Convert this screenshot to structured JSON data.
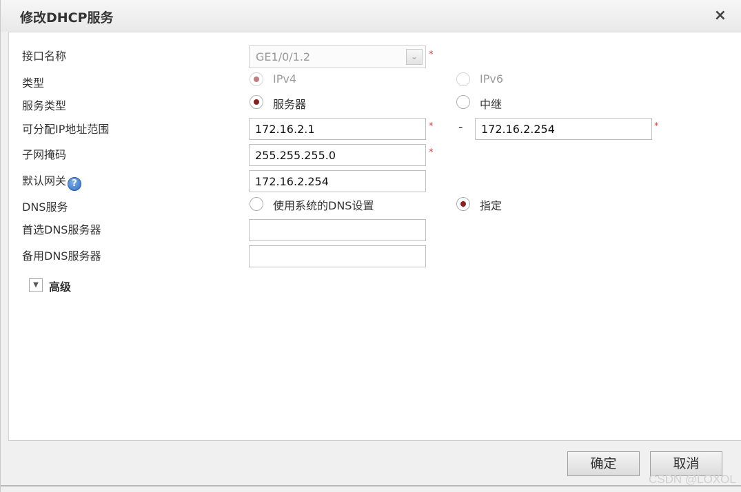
{
  "dialog": {
    "title": "修改DHCP服务",
    "close_symbol": "×"
  },
  "fields": {
    "interface_name": {
      "label": "接口名称",
      "value": "GE1/0/1.2",
      "required": "*"
    },
    "type": {
      "label": "类型",
      "options": [
        "IPv4",
        "IPv6"
      ],
      "selected": "IPv4"
    },
    "service_type": {
      "label": "服务类型",
      "options": [
        "服务器",
        "中继"
      ],
      "selected": "服务器"
    },
    "ip_range": {
      "label": "可分配IP地址范围",
      "start": "172.16.2.1",
      "separator": "-",
      "end": "172.16.2.254",
      "required": "*"
    },
    "subnet_mask": {
      "label": "子网掩码",
      "value": "255.255.255.0",
      "required": "*"
    },
    "default_gateway": {
      "label": "默认网关",
      "value": "172.16.2.254",
      "help_symbol": "?"
    },
    "dns_service": {
      "label": "DNS服务",
      "options": [
        "使用系统的DNS设置",
        "指定"
      ],
      "selected": "指定"
    },
    "primary_dns": {
      "label": "首选DNS服务器",
      "value": ""
    },
    "secondary_dns": {
      "label": "备用DNS服务器",
      "value": ""
    }
  },
  "advanced": {
    "label": "高级"
  },
  "buttons": {
    "ok": "确定",
    "cancel": "取消"
  },
  "watermark": "CSDN @LOXOL"
}
